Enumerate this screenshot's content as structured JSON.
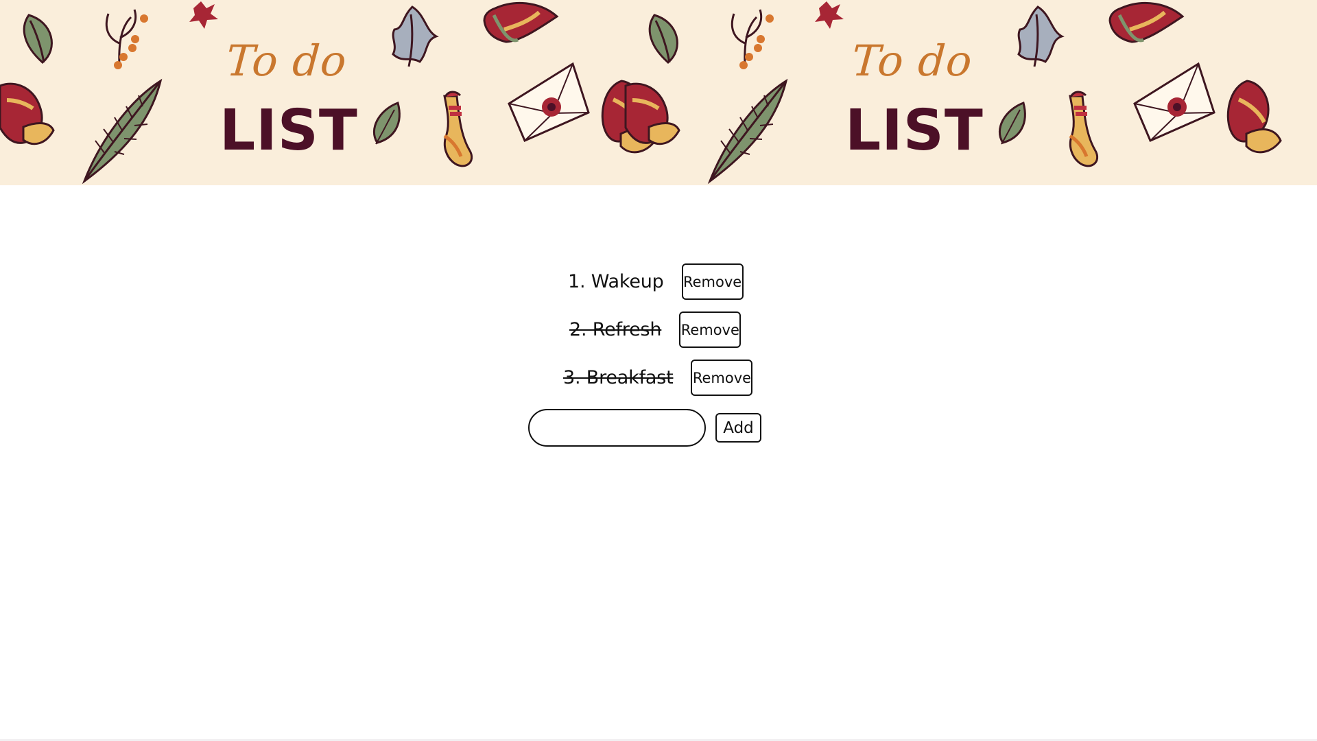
{
  "banner": {
    "title_small": "To do",
    "title_large": "LIST",
    "background": "#faeedb",
    "accent_orange": "#c9772e",
    "accent_dark": "#4c1027",
    "illustration_icons": [
      "mitten-icon",
      "leaf-icon",
      "berry-branch-icon",
      "oak-leaf-icon",
      "envelope-icon",
      "sock-icon",
      "maple-leaf-icon"
    ]
  },
  "todo": {
    "items": [
      {
        "label": "1. Wakeup",
        "completed": false,
        "remove_label": "Remove"
      },
      {
        "label": "2. Refresh",
        "completed": true,
        "remove_label": "Remove"
      },
      {
        "label": "3. Breakfast",
        "completed": true,
        "remove_label": "Remove"
      }
    ],
    "input_value": "",
    "add_label": "Add"
  }
}
